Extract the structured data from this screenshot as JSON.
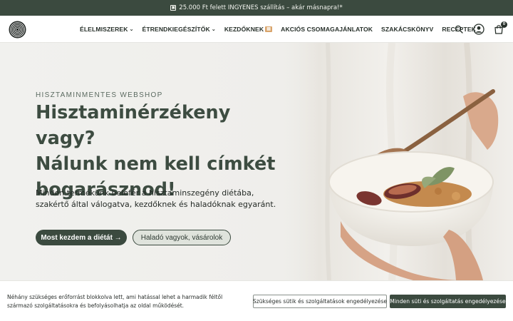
{
  "announcement": {
    "text": "25.000 Ft felett INGYENES szállítás – akár másnapra!*",
    "icon": "gift-icon"
  },
  "header": {
    "logo_icon": "concentric-circles-logo",
    "nav": [
      {
        "label": "ÉLELMISZEREK",
        "has_dropdown": true
      },
      {
        "label": "ÉTRENDKIEGÉSZÍTŐK",
        "has_dropdown": true
      },
      {
        "label": "KEZDŐKNEK",
        "badge_icon": "book-badge-icon"
      },
      {
        "label": "AKCIÓS CSOMAGAJÁNLATOK"
      },
      {
        "label": "SZAKÁCSKÖNYV"
      },
      {
        "label": "RECEPTEK"
      }
    ],
    "cart_count": "0"
  },
  "hero": {
    "eyebrow": "HISZTAMINMENTES WEBSHOP",
    "headline_line1": "Hisztaminérzékeny vagy?",
    "headline_line2": "Nálunk nem kell címkét",
    "headline_line3": "bogarásznod!",
    "subtext": "Minden termékünk belefér a hisztaminszegény diétába, szakértő által válogatva, kezdőknek és haladóknak egyaránt.",
    "primary_cta": "Most kezdem a diétát →",
    "secondary_cta": "Haladó vagyok, vásárolok"
  },
  "cookie": {
    "text": "Néhány szükséges erőforrást blokkolva lett, ami hatással lehet a harmadik féltől származó szolgáltatásokra és befolyásolhatja az oldal működését.",
    "btn_necessary": "Szükséges sütik és szolgáltatások engedélyezése",
    "btn_all": "Minden süti és szolgáltatás engedélyezése"
  },
  "colors": {
    "brand_dark_green": "#3b4a3f",
    "hero_bg": "#f1f1ee",
    "headline": "#3d4c41"
  }
}
